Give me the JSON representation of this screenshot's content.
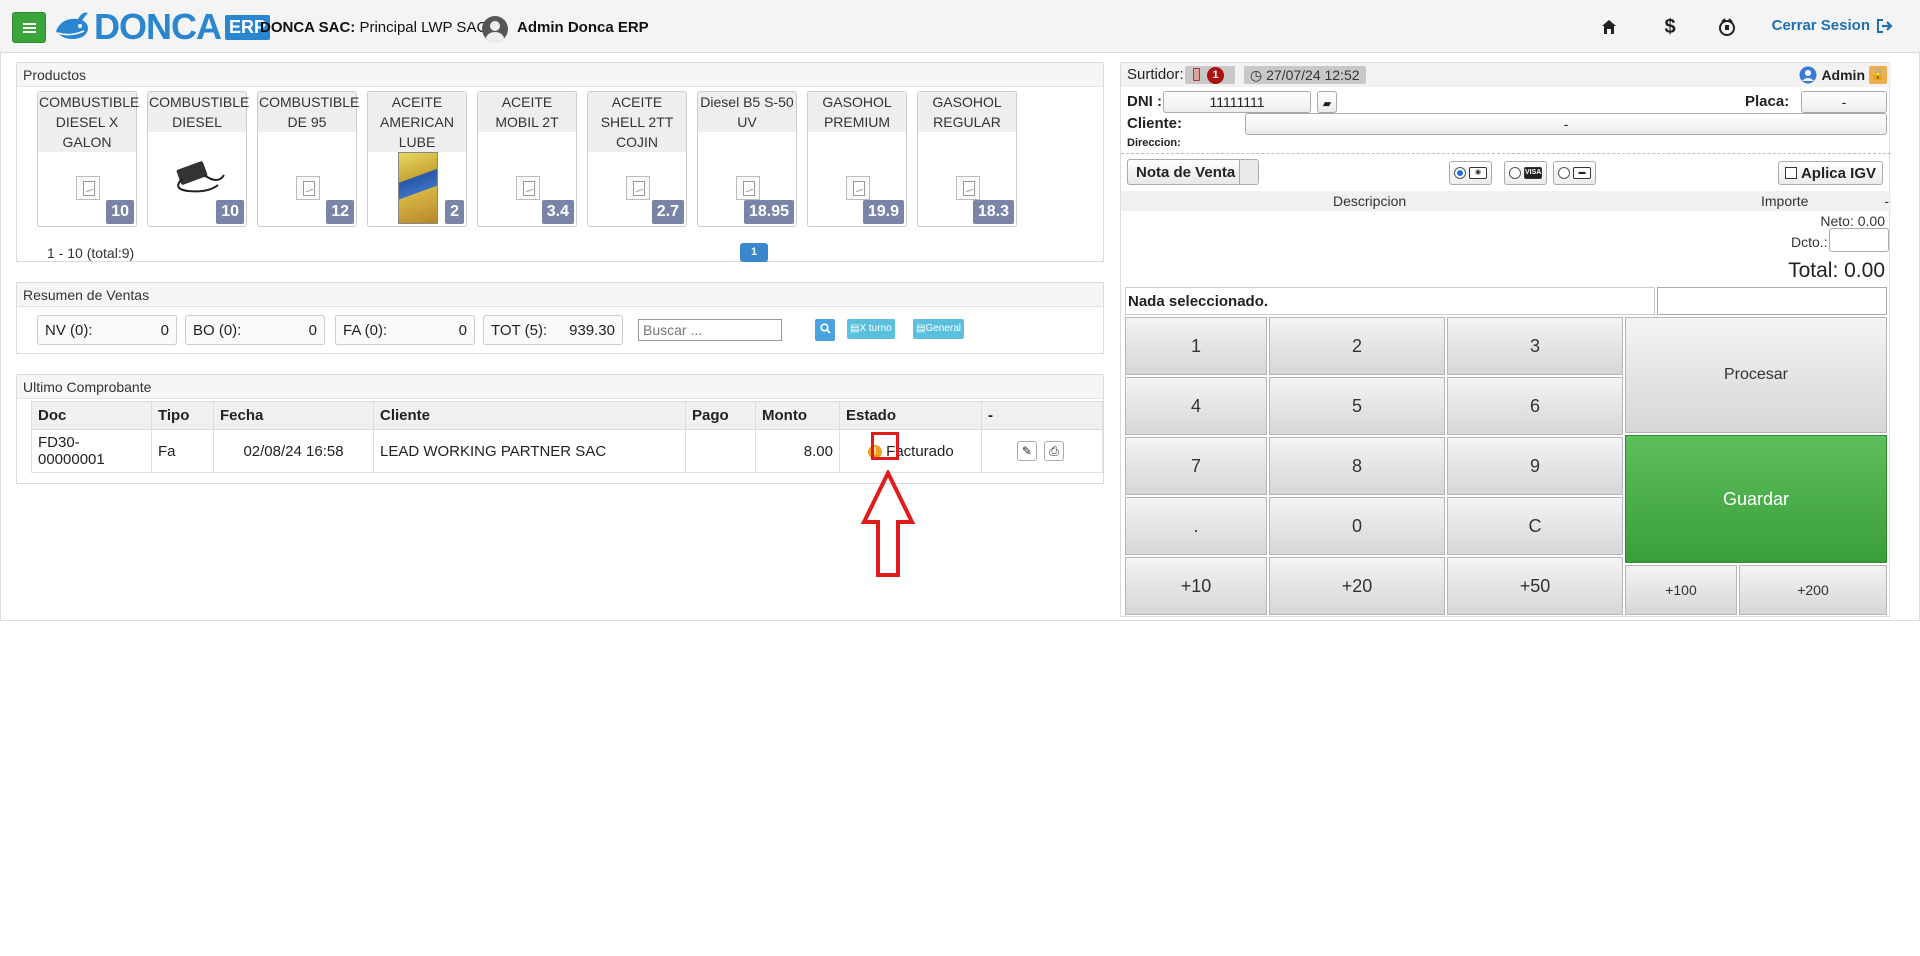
{
  "header": {
    "brand": "DONCA",
    "brand_suffix": "ERP",
    "company_label": "DONCA SAC:",
    "branch": "Principal LWP SAC |",
    "user": "Admin Donca ERP",
    "logout": "Cerrar Sesion"
  },
  "products": {
    "title": "Productos",
    "items": [
      {
        "name": "COMBUSTIBLE DIESEL X GALON",
        "price": "10"
      },
      {
        "name": "COMBUSTIBLE DIESEL",
        "price": "10"
      },
      {
        "name": "COMBUSTIBLE DE 95",
        "price": "12"
      },
      {
        "name": "ACEITE AMERICAN LUBE",
        "price": "2"
      },
      {
        "name": "ACEITE MOBIL 2T",
        "price": "3.4"
      },
      {
        "name": "ACEITE SHELL 2TT COJIN",
        "price": "2.7"
      },
      {
        "name": "Diesel B5 S-50 UV",
        "price": "18.95"
      },
      {
        "name": "GASOHOL PREMIUM",
        "price": "19.9"
      },
      {
        "name": "GASOHOL REGULAR",
        "price": "18.3"
      }
    ],
    "pager_info": "1 - 10 (total:9)",
    "current_page": "1"
  },
  "summary": {
    "title": "Resumen de Ventas",
    "boxes": [
      {
        "label": "NV (0):",
        "value": "0"
      },
      {
        "label": "BO (0):",
        "value": "0"
      },
      {
        "label": "FA (0):",
        "value": "0"
      },
      {
        "label": "TOT (5):",
        "value": "939.30"
      }
    ],
    "search_placeholder": "Buscar ...",
    "btn_turno": "X turno",
    "btn_general": "General"
  },
  "last_receipt": {
    "title": "Ultimo Comprobante",
    "columns": [
      "Doc",
      "Tipo",
      "Fecha",
      "Cliente",
      "Pago",
      "Monto",
      "Estado",
      "-"
    ],
    "row": {
      "doc": "FD30-00000001",
      "tipo": "Fa",
      "fecha": "02/08/24 16:58",
      "cliente": "LEAD WORKING PARTNER SAC",
      "pago": "",
      "monto": "8.00",
      "estado": "Facturado"
    }
  },
  "pos": {
    "surtidor_label": "Surtidor:",
    "surtidor_count": "1",
    "datetime": "27/07/24 12:52",
    "admin": "Admin",
    "dni_label": "DNI :",
    "dni_value": "11111111",
    "placa_label": "Placa:",
    "placa_value": "-",
    "cliente_label": "Cliente:",
    "cliente_value": "-",
    "direccion_label": "Direccion:",
    "doc_type": "Nota de Venta",
    "igv_label": "Aplica IGV",
    "col_descripcion": "Descripcion",
    "col_importe": "Importe",
    "col_dash": "-",
    "neto": "Neto: 0.00",
    "dcto_label": "Dcto.:",
    "total": "Total: 0.00",
    "selection": "Nada seleccionado.",
    "keys": {
      "k1": "1",
      "k2": "2",
      "k3": "3",
      "k4": "4",
      "k5": "5",
      "k6": "6",
      "k7": "7",
      "k8": "8",
      "k9": "9",
      "kdot": ".",
      "k0": "0",
      "kc": "C",
      "p10": "+10",
      "p20": "+20",
      "p50": "+50",
      "p100": "+100",
      "p200": "+200",
      "procesar": "Procesar",
      "guardar": "Guardar"
    }
  },
  "colors": {
    "accent_blue": "#2a86d1",
    "green": "#3aa53a",
    "price_badge": "#7a84a8",
    "highlight_red": "#e01b1b"
  }
}
